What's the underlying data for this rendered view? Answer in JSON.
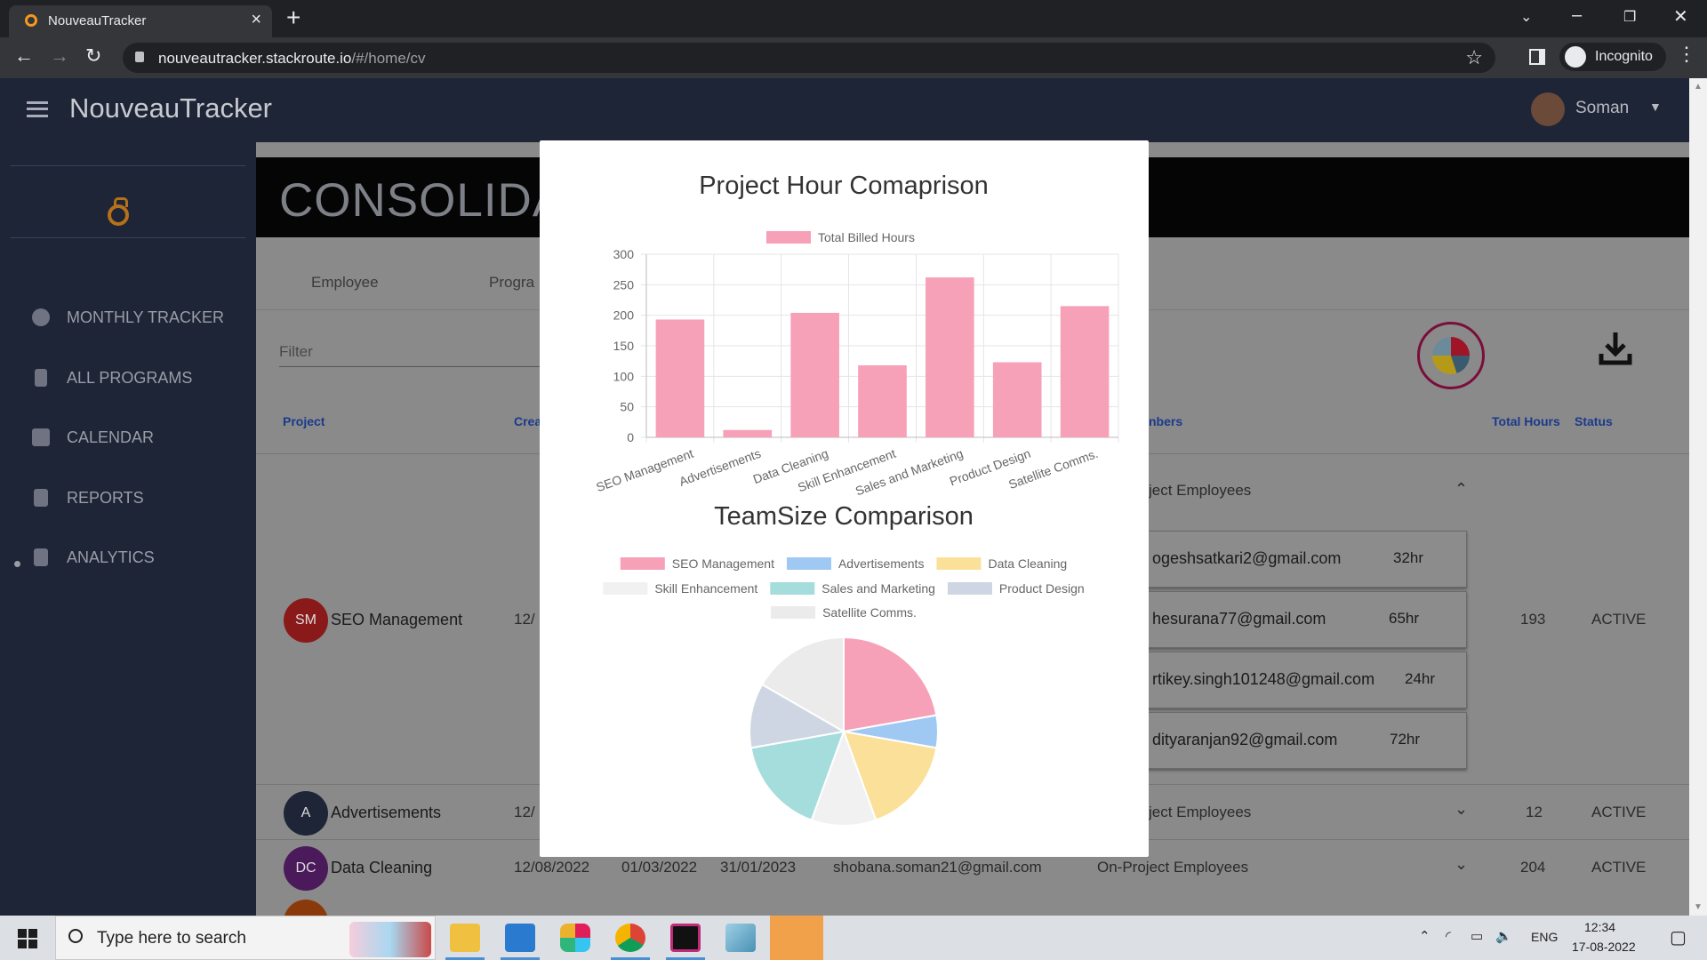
{
  "browser": {
    "tab_title": "NouveauTracker",
    "url_host": "nouveautracker.stackroute.io",
    "url_path": "/#/home/cv",
    "profile_label": "Incognito"
  },
  "app": {
    "brand": "NouveauTracker",
    "user_name": "Soman",
    "banner_title": "CONSOLIDA",
    "sidebar": [
      {
        "label": "MONTHLY TRACKER",
        "icon": "clock-icon"
      },
      {
        "label": "ALL PROGRAMS",
        "icon": "pin-icon"
      },
      {
        "label": "CALENDAR",
        "icon": "calendar-icon"
      },
      {
        "label": "REPORTS",
        "icon": "document-icon"
      },
      {
        "label": "ANALYTICS",
        "icon": "document-icon"
      }
    ],
    "tabs": [
      "Employee",
      "Progra"
    ],
    "filter_placeholder": "Filter",
    "columns": {
      "project": "Project",
      "created": "Crea",
      "members": "nbers",
      "total_hours": "Total Hours",
      "status": "Status"
    },
    "rows": [
      {
        "initials": "SM",
        "name": "SEO Management",
        "created": "12/",
        "members_label": "ject Employees",
        "total": "193",
        "status": "ACTIVE"
      },
      {
        "initials": "A",
        "name": "Advertisements",
        "created": "12/",
        "members_label": "ject Employees",
        "total": "12",
        "status": "ACTIVE"
      },
      {
        "initials": "DC",
        "name": "Data Cleaning",
        "created": "12/08/2022",
        "start": "01/03/2022",
        "end": "31/01/2023",
        "manager": "shobana.soman21@gmail.com",
        "members_label": "On-Project Employees",
        "total": "204",
        "status": "ACTIVE"
      }
    ],
    "members": [
      {
        "email": "ogeshsatkari2@gmail.com",
        "hours": "32hr"
      },
      {
        "email": "hesurana77@gmail.com",
        "hours": "65hr"
      },
      {
        "email": "rtikey.singh101248@gmail.com",
        "hours": "24hr"
      },
      {
        "email": "dityaranjan92@gmail.com",
        "hours": "72hr"
      }
    ]
  },
  "modal": {
    "chart_data": [
      {
        "type": "bar",
        "title": "Project Hour Comaprison",
        "legend": "top",
        "categories": [
          "SEO Management",
          "Advertisements",
          "Data Cleaning",
          "Skill Enhancement",
          "Sales and Marketing",
          "Product Design",
          "Satellite Comms."
        ],
        "series": [
          {
            "name": "Total Billed Hours",
            "values": [
              193,
              12,
              204,
              118,
              262,
              123,
              215
            ],
            "color": "#f7a1b8"
          }
        ],
        "ylim": [
          0,
          300
        ],
        "yticks": [
          0,
          50,
          100,
          150,
          200,
          250,
          300
        ],
        "grid": true
      },
      {
        "type": "pie",
        "title": "TeamSize Comparison",
        "legend": "top",
        "categories": [
          "SEO Management",
          "Advertisements",
          "Data Cleaning",
          "Skill Enhancement",
          "Sales and Marketing",
          "Product Design",
          "Satellite Comms."
        ],
        "values": [
          4,
          1,
          3,
          2,
          3,
          2,
          3
        ],
        "colors": [
          "#f7a1b8",
          "#9fc9f3",
          "#fbe09a",
          "#f1f1f1",
          "#a5dcdc",
          "#cdd6e2",
          "#ebebeb"
        ]
      }
    ]
  },
  "taskbar": {
    "search_text": "Type here to search",
    "language": "ENG",
    "time": "12:34",
    "date": "17-08-2022"
  }
}
